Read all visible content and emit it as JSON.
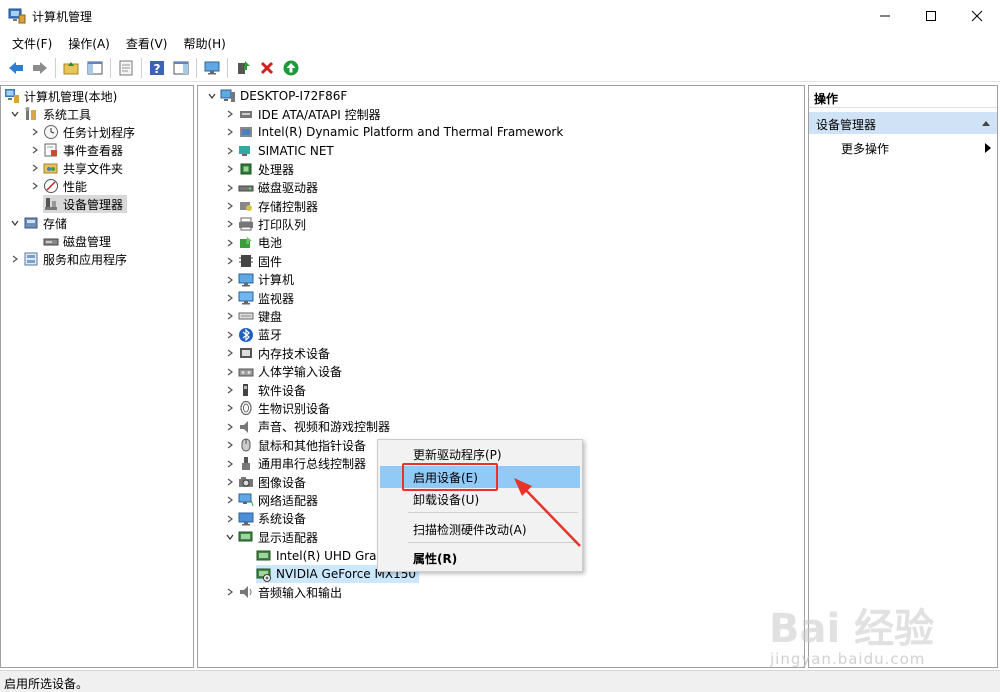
{
  "window": {
    "title": "计算机管理"
  },
  "menu": [
    "文件(F)",
    "操作(A)",
    "查看(V)",
    "帮助(H)"
  ],
  "left_tree": [
    {
      "label": "计算机管理(本地)",
      "icon": "computer-management-icon",
      "level": 0,
      "expander": "none"
    },
    {
      "label": "系统工具",
      "icon": "system-tools-icon",
      "level": 1,
      "expander": "expanded"
    },
    {
      "label": "任务计划程序",
      "icon": "task-scheduler-icon",
      "level": 2,
      "expander": "collapsed"
    },
    {
      "label": "事件查看器",
      "icon": "event-viewer-icon",
      "level": 2,
      "expander": "collapsed"
    },
    {
      "label": "共享文件夹",
      "icon": "shared-folders-icon",
      "level": 2,
      "expander": "collapsed"
    },
    {
      "label": "性能",
      "icon": "performance-icon",
      "level": 2,
      "expander": "collapsed"
    },
    {
      "label": "设备管理器",
      "icon": "device-manager-icon",
      "level": 2,
      "expander": "none",
      "selected": true
    },
    {
      "label": "存储",
      "icon": "storage-icon",
      "level": 1,
      "expander": "expanded"
    },
    {
      "label": "磁盘管理",
      "icon": "disk-management-icon",
      "level": 2,
      "expander": "none"
    },
    {
      "label": "服务和应用程序",
      "icon": "services-icon",
      "level": 1,
      "expander": "collapsed"
    }
  ],
  "device_tree": {
    "root": "DESKTOP-I72F86F",
    "categories": [
      {
        "label": "IDE ATA/ATAPI 控制器",
        "icon": "ide-controller-icon"
      },
      {
        "label": "Intel(R) Dynamic Platform and Thermal Framework",
        "icon": "thermal-framework-icon"
      },
      {
        "label": "SIMATIC NET",
        "icon": "simatic-net-icon"
      },
      {
        "label": "处理器",
        "icon": "processor-icon"
      },
      {
        "label": "磁盘驱动器",
        "icon": "disk-drive-icon"
      },
      {
        "label": "存储控制器",
        "icon": "storage-controller-icon"
      },
      {
        "label": "打印队列",
        "icon": "printer-icon"
      },
      {
        "label": "电池",
        "icon": "battery-icon"
      },
      {
        "label": "固件",
        "icon": "firmware-icon"
      },
      {
        "label": "计算机",
        "icon": "computer-icon"
      },
      {
        "label": "监视器",
        "icon": "monitor-icon"
      },
      {
        "label": "键盘",
        "icon": "keyboard-icon"
      },
      {
        "label": "蓝牙",
        "icon": "bluetooth-icon"
      },
      {
        "label": "内存技术设备",
        "icon": "memory-device-icon"
      },
      {
        "label": "人体学输入设备",
        "icon": "hid-icon"
      },
      {
        "label": "软件设备",
        "icon": "software-device-icon"
      },
      {
        "label": "生物识别设备",
        "icon": "biometric-icon"
      },
      {
        "label": "声音、视频和游戏控制器",
        "icon": "sound-icon"
      },
      {
        "label": "鼠标和其他指针设备",
        "icon": "mouse-icon"
      },
      {
        "label": "通用串行总线控制器",
        "icon": "usb-icon"
      },
      {
        "label": "图像设备",
        "icon": "camera-icon"
      },
      {
        "label": "网络适配器",
        "icon": "network-adapter-icon"
      },
      {
        "label": "系统设备",
        "icon": "system-device-icon"
      },
      {
        "label": "显示适配器",
        "icon": "display-adapter-icon",
        "expanded": true
      },
      {
        "label": "Intel(R) UHD Grap",
        "icon": "display-adapter-icon",
        "child": true
      },
      {
        "label": "NVIDIA GeForce MX150",
        "icon": "display-adapter-disabled-icon",
        "child": true,
        "selected": true
      },
      {
        "label": "音频输入和输出",
        "icon": "audio-io-icon"
      }
    ]
  },
  "actions_pane": {
    "header": "操作",
    "section": "设备管理器",
    "more": "更多操作"
  },
  "context_menu": {
    "items": [
      "更新驱动程序(P)",
      "启用设备(E)",
      "卸载设备(U)",
      "扫描检测硬件改动(A)",
      "属性(R)"
    ],
    "highlighted": "启用设备(E)"
  },
  "status": "启用所选设备。",
  "colors": {
    "annotation_red": "#e8332b",
    "menu_highlight": "#91c9f7",
    "actions_section": "#cfe2f6"
  },
  "watermark": {
    "logo": "Bai 经验",
    "url": "jingyan.baidu.com"
  }
}
